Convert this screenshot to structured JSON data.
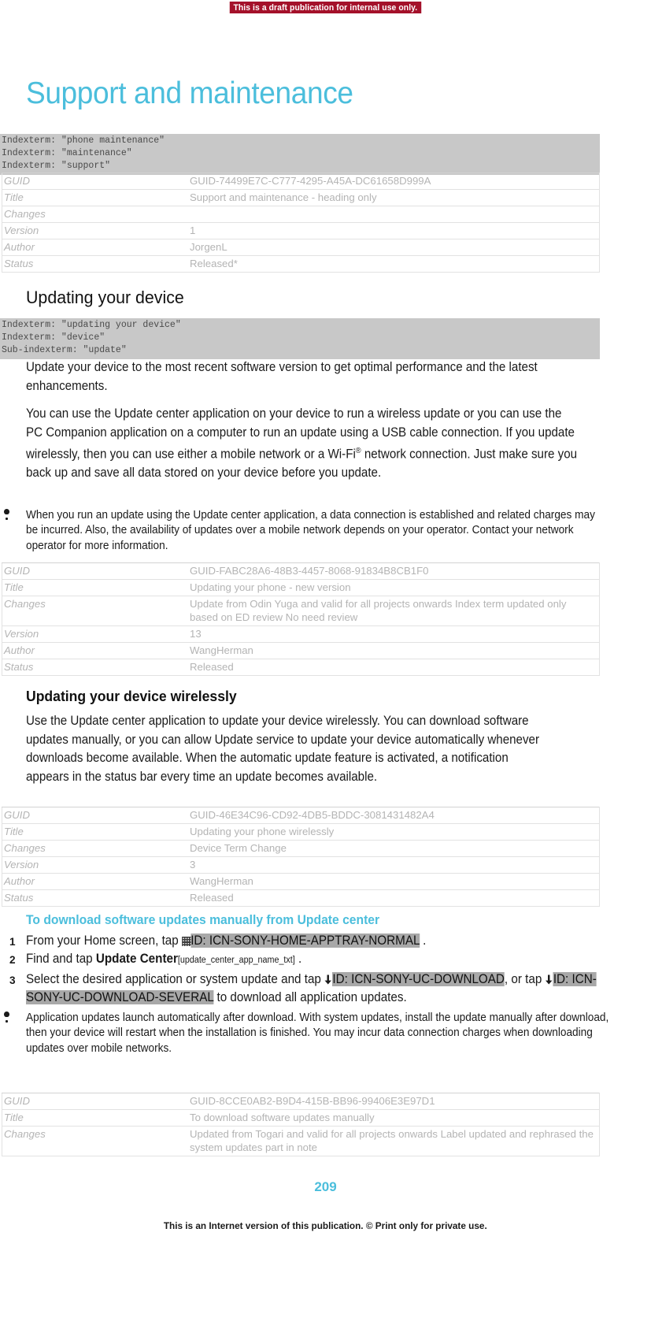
{
  "draft_banner": "This is a draft publication for internal use only.",
  "page_title": "Support and maintenance",
  "accent_color": "#4bbedc",
  "banner_color": "#a4112a",
  "highlight_color": "#a8a8a8",
  "indexterm_bg": "#c8c8c8",
  "sections": {
    "support_maintenance": {
      "indexterms": [
        "Indexterm: \"phone maintenance\"",
        "Indexterm: \"maintenance\"",
        "Indexterm: \"support\""
      ],
      "meta": {
        "headers": [
          "GUID",
          "Title",
          "Changes",
          "Version",
          "Author",
          "Status"
        ],
        "rows": [
          {
            "key": "GUID",
            "value": "GUID-74499E7C-C777-4295-A45A-DC61658D999A"
          },
          {
            "key": "Title",
            "value": "Support and maintenance - heading only"
          },
          {
            "key": "Changes",
            "value": ""
          },
          {
            "key": "Version",
            "value": "1"
          },
          {
            "key": "Author",
            "value": "JorgenL"
          },
          {
            "key": "Status",
            "value": "Released*"
          }
        ]
      }
    },
    "updating_your_device": {
      "heading": "Updating your device",
      "indexterms": [
        "Indexterm: \"updating your device\"",
        "Indexterm: \"device\"",
        "Sub-indexterm: \"update\""
      ],
      "para1": "Update your device to the most recent software version to get optimal performance and the latest enhancements.",
      "para2_a": "You can use the Update center application on your device to run a wireless update or you can use the PC Companion application on a computer to run an update using a USB cable connection. If you update wirelessly, then you can use either a mobile network or a Wi-Fi",
      "para2_sup": "®",
      "para2_b": " network connection. Just make sure you back up and save all data stored on your device before you update.",
      "note": "When you run an update using the Update center application, a data connection is established and related charges may be incurred. Also, the availability of updates over a mobile network depends on your operator. Contact your network operator for more information.",
      "meta": {
        "rows": [
          {
            "key": "GUID",
            "value": "GUID-FABC28A6-48B3-4457-8068-91834B8CB1F0"
          },
          {
            "key": "Title",
            "value": "Updating your phone - new version"
          },
          {
            "key": "Changes",
            "value": "Update from Odin Yuga and valid for all projects onwards Index term updated only based on ED review No need review"
          },
          {
            "key": "Version",
            "value": "13"
          },
          {
            "key": "Author",
            "value": "WangHerman"
          },
          {
            "key": "Status",
            "value": "Released"
          }
        ]
      }
    },
    "updating_wirelessly": {
      "heading": "Updating your device wirelessly",
      "para1": "Use the Update center application to update your device wirelessly. You can download software updates manually, or you can allow Update service to update your device automatically whenever downloads become available. When the automatic update feature is activated, a notification appears in the status bar every time an update becomes available.",
      "meta": {
        "rows": [
          {
            "key": "GUID",
            "value": "GUID-46E34C96-CD92-4DB5-BDDC-3081431482A4"
          },
          {
            "key": "Title",
            "value": "Updating your phone wirelessly"
          },
          {
            "key": "Changes",
            "value": "Device Term Change"
          },
          {
            "key": "Version",
            "value": "3"
          },
          {
            "key": "Author",
            "value": "WangHerman"
          },
          {
            "key": "Status",
            "value": "Released"
          }
        ]
      }
    },
    "procedure": {
      "heading": "To download software updates manually from Update center",
      "steps": [
        {
          "number": "1",
          "parts": [
            {
              "type": "text",
              "text": "From your Home screen, tap "
            },
            {
              "type": "icon",
              "icon": "apptray-grid-icon"
            },
            {
              "type": "highlight",
              "text": "ID: ICN-SONY-HOME-APPTRAY-NORMAL"
            },
            {
              "type": "text",
              "text": " ."
            }
          ]
        },
        {
          "number": "2",
          "parts": [
            {
              "type": "text",
              "text": "Find and tap "
            },
            {
              "type": "bold",
              "text": "Update Center"
            },
            {
              "type": "varname",
              "text": "[update_center_app_name_txt]"
            },
            {
              "type": "text",
              "text": " ."
            }
          ]
        },
        {
          "number": "3",
          "parts": [
            {
              "type": "text",
              "text": "Select the desired application or system update and tap "
            },
            {
              "type": "icon",
              "icon": "download-arrow-icon"
            },
            {
              "type": "highlight",
              "text": "ID: ICN-SONY-UC-DOWNLOAD"
            },
            {
              "type": "text",
              "text": ", or tap "
            },
            {
              "type": "icon",
              "icon": "download-arrow-icon"
            },
            {
              "type": "highlight",
              "text": "ID: ICN-SONY-UC-DOWNLOAD-SEVERAL"
            },
            {
              "type": "text",
              "text": " to download all application updates."
            }
          ]
        }
      ],
      "note": "Application updates launch automatically after download. With system updates, install the update manually after download, then your device will restart when the installation is finished. You may incur data connection charges when downloading updates over mobile networks.",
      "meta": {
        "rows": [
          {
            "key": "GUID",
            "value": "GUID-8CCE0AB2-B9D4-415B-BB96-99406E3E97D1"
          },
          {
            "key": "Title",
            "value": "To download software updates manually"
          },
          {
            "key": "Changes",
            "value": "Updated from Togari and valid for all projects onwards Label updated and rephrased the system updates part in note"
          }
        ]
      }
    }
  },
  "footer": {
    "page_number": "209",
    "text": "This is an Internet version of this publication. © Print only for private use."
  }
}
